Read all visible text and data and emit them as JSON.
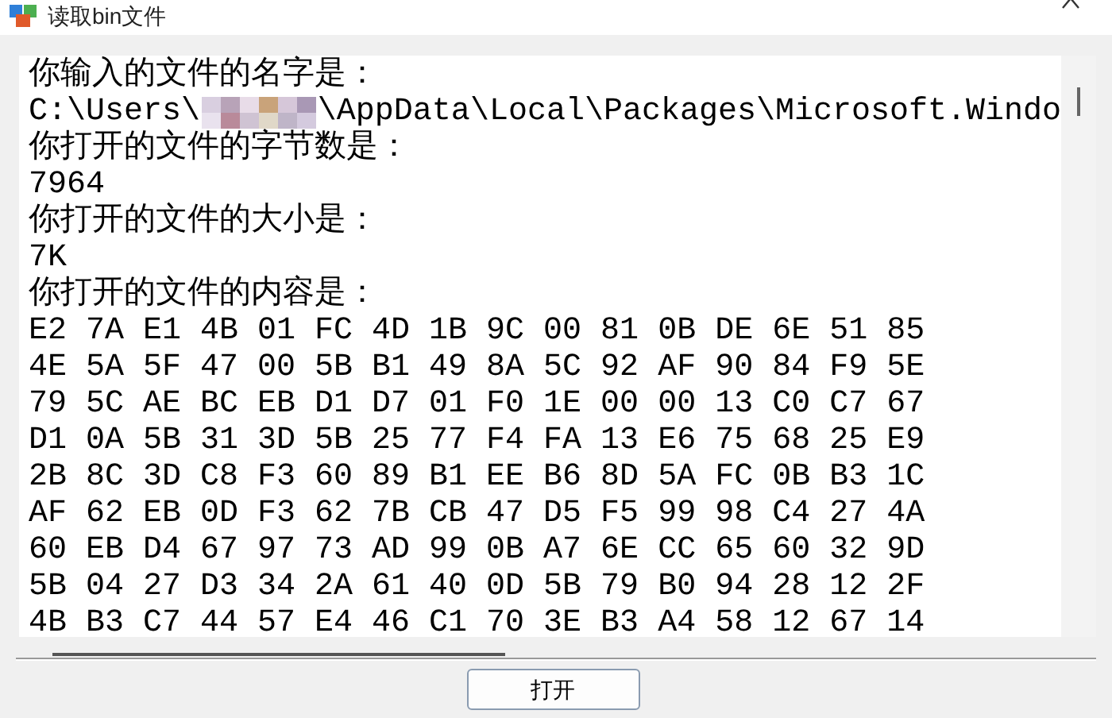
{
  "window": {
    "title": "读取bin文件"
  },
  "output": {
    "lines": [
      {
        "kind": "text",
        "text": "你输入的文件的名字是："
      },
      {
        "kind": "path",
        "before": "C:\\Users\\",
        "after": "\\AppData\\Local\\Packages\\Microsoft.Windo"
      },
      {
        "kind": "text",
        "text": "你打开的文件的字节数是："
      },
      {
        "kind": "text",
        "text": "7964"
      },
      {
        "kind": "text",
        "text": "你打开的文件的大小是："
      },
      {
        "kind": "text",
        "text": "7K"
      },
      {
        "kind": "text",
        "text": "你打开的文件的内容是："
      },
      {
        "kind": "text",
        "text": "E2 7A E1 4B 01 FC 4D 1B 9C 00 81 0B DE 6E 51 85"
      },
      {
        "kind": "text",
        "text": "4E 5A 5F 47 00 5B B1 49 8A 5C 92 AF 90 84 F9 5E"
      },
      {
        "kind": "text",
        "text": "79 5C AE BC EB D1 D7 01 F0 1E 00 00 13 C0 C7 67"
      },
      {
        "kind": "text",
        "text": "D1 0A 5B 31 3D 5B 25 77 F4 FA 13 E6 75 68 25 E9"
      },
      {
        "kind": "text",
        "text": "2B 8C 3D C8 F3 60 89 B1 EE B6 8D 5A FC 0B B3 1C"
      },
      {
        "kind": "text",
        "text": "AF 62 EB 0D F3 62 7B CB 47 D5 F5 99 98 C4 27 4A"
      },
      {
        "kind": "text",
        "text": "60 EB D4 67 97 73 AD 99 0B A7 6E CC 65 60 32 9D"
      },
      {
        "kind": "text",
        "text": "5B 04 27 D3 34 2A 61 40 0D 5B 79 B0 94 28 12 2F"
      },
      {
        "kind": "text",
        "text": "4B B3 C7 44 57 E4 46 C1 70 3E B3 A4 58 12 67 14"
      }
    ]
  },
  "buttons": [
    {
      "label": "打开"
    }
  ]
}
